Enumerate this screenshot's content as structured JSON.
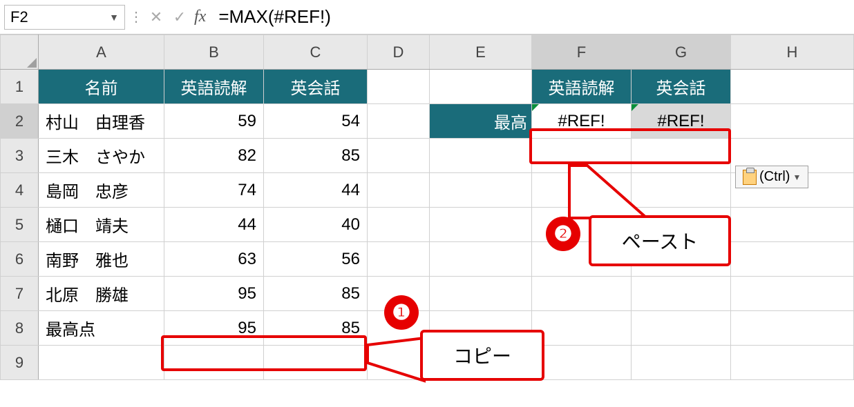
{
  "namebox": "F2",
  "formula": "=MAX(#REF!)",
  "fx": "fx",
  "columns": [
    "A",
    "B",
    "C",
    "D",
    "E",
    "F",
    "G",
    "H"
  ],
  "rows": [
    "1",
    "2",
    "3",
    "4",
    "5",
    "6",
    "7",
    "8",
    "9"
  ],
  "headers": {
    "A": "名前",
    "B": "英語読解",
    "C": "英会話",
    "F": "英語読解",
    "G": "英会話"
  },
  "row2": {
    "name": "村山　由理香",
    "b": "59",
    "c": "54",
    "e": "最高",
    "f": "#REF!",
    "g": "#REF!"
  },
  "row3": {
    "name": "三木　さやか",
    "b": "82",
    "c": "85"
  },
  "row4": {
    "name": "島岡　忠彦",
    "b": "74",
    "c": "44"
  },
  "row5": {
    "name": "樋口　靖夫",
    "b": "44",
    "c": "40"
  },
  "row6": {
    "name": "南野　雅也",
    "b": "63",
    "c": "56"
  },
  "row7": {
    "name": "北原　勝雄",
    "b": "95",
    "c": "85"
  },
  "row8": {
    "name": "最高点",
    "b": "95",
    "c": "85"
  },
  "callouts": {
    "num1": "❶",
    "num2": "❷",
    "copy": "コピー",
    "paste": "ペースト"
  },
  "pasteOptions": "(Ctrl)",
  "warn": "!",
  "chart_data": {
    "type": "table",
    "title": "",
    "columns": [
      "名前",
      "英語読解",
      "英会話"
    ],
    "rows": [
      [
        "村山　由理香",
        59,
        54
      ],
      [
        "三木　さやか",
        82,
        85
      ],
      [
        "島岡　忠彦",
        74,
        44
      ],
      [
        "樋口　靖夫",
        44,
        40
      ],
      [
        "南野　雅也",
        63,
        56
      ],
      [
        "北原　勝雄",
        95,
        85
      ],
      [
        "最高点",
        95,
        85
      ]
    ]
  }
}
